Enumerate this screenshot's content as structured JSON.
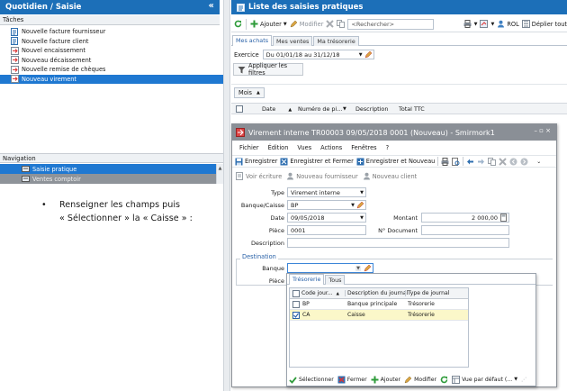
{
  "left": {
    "title": "Quotidien / Saisie",
    "collapse_glyph": "«",
    "tasks_label": "Tâches",
    "tasks": [
      {
        "label": "Nouvelle facture fournisseur",
        "selected": false
      },
      {
        "label": "Nouvelle facture client",
        "selected": false
      },
      {
        "label": "Nouvel encaissement",
        "selected": false
      },
      {
        "label": "Nouveau décaissement",
        "selected": false
      },
      {
        "label": "Nouvelle remise de chèques",
        "selected": false
      },
      {
        "label": "Nouveau virement",
        "selected": true
      }
    ],
    "navigation_label": "Navigation",
    "nav_items": [
      {
        "label": "Saisie pratique",
        "selected": true
      },
      {
        "label": "Ventes comptoir",
        "selected": false
      }
    ]
  },
  "instruction": {
    "bullet": "•",
    "line1": "Renseigner les champs puis",
    "line2": "« Sélectionner » la « Caisse » :"
  },
  "list": {
    "title": "Liste des saisies pratiques",
    "toolbar": {
      "add": "Ajouter",
      "edit": "Modifier",
      "search_placeholder": "<Rechercher>",
      "rol": "ROL",
      "expand": "Déplier tout"
    },
    "tabs": [
      "Mes achats",
      "Mes ventes",
      "Ma trésorerie"
    ],
    "exercise_label": "Exercice",
    "exercise_value": "Du 01/01/18 au 31/12/18",
    "apply_filters": "Appliquer les filtres",
    "group_chip": "Mois",
    "columns": [
      "Date",
      "Numéro de pi...",
      "Description",
      "Total TTC"
    ]
  },
  "dialog": {
    "title": "Virement interne TR00003 09/05/2018 0001 (Nouveau) - Smirmork1",
    "window_controls": "– ▫ ×",
    "menu": [
      "Fichier",
      "Édition",
      "Vues",
      "Actions",
      "Fenêtres",
      "?"
    ],
    "toolbar": {
      "save": "Enregistrer",
      "save_close": "Enregistrer et Fermer",
      "save_new": "Enregistrer et Nouveau"
    },
    "toolbar2": {
      "view_entry": "Voir écriture",
      "new_supplier": "Nouveau fournisseur",
      "new_client": "Nouveau client"
    },
    "form": {
      "type_label": "Type",
      "type_value": "Virement interne",
      "bank_label": "Banque/Caisse",
      "bank_value": "BP",
      "date_label": "Date",
      "date_value": "09/05/2018",
      "amount_label": "Montant",
      "amount_value": "2 000,00",
      "piece_label": "Pièce",
      "piece_value": "0001",
      "doc_label": "N° Document",
      "doc_value": "",
      "description_label": "Description",
      "description_value": ""
    },
    "destination": {
      "legend": "Destination",
      "bank_label": "Banque",
      "bank_value": "",
      "piece_label": "Pièce"
    },
    "dropdown": {
      "tabs": [
        "Trésorerie",
        "Tous"
      ],
      "columns": [
        "Code jour...",
        "Description du journal",
        "Type de journal"
      ],
      "rows": [
        {
          "code": "BP",
          "description": "Banque principale",
          "type": "Trésorerie",
          "checked": false
        },
        {
          "code": "CA",
          "description": "Caisse",
          "type": "Trésorerie",
          "checked": true
        }
      ],
      "footer": {
        "select": "Sélectionner",
        "close": "Fermer",
        "add": "Ajouter",
        "edit": "Modifier",
        "view": "Vue par défaut (..."
      }
    }
  },
  "colors": {
    "header_blue": "#1c6fb8",
    "selection_blue": "#1f78d1",
    "dialog_title_grey": "#8a8f96",
    "highlight_row": "#fbf7c9",
    "add_green": "#2e9b3a",
    "delete_red": "#d33"
  }
}
